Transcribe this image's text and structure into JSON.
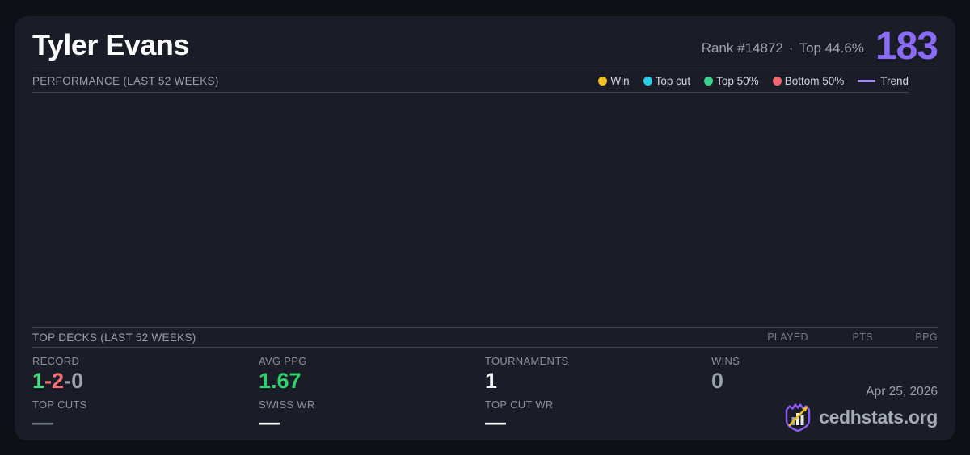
{
  "page": {
    "background": "#0f1015",
    "card_background": "#1a1d28"
  },
  "header": {
    "player_name": "Tyler Evans",
    "rank_text": "Rank #14872",
    "separator": "·",
    "top_percent": "Top 44.6%",
    "score": "183",
    "score_color": "#8b6af5"
  },
  "performance": {
    "title": "PERFORMANCE (LAST 52 WEEKS)",
    "legend": [
      {
        "label": "Win",
        "color": "#f0c020",
        "marker": "dot"
      },
      {
        "label": "Top cut",
        "color": "#29cde6",
        "marker": "dot"
      },
      {
        "label": "Top 50%",
        "color": "#3ecf8d",
        "marker": "dot"
      },
      {
        "label": "Bottom 50%",
        "color": "#f5676e",
        "marker": "dot"
      },
      {
        "label": "Trend",
        "color": "#a78bfa",
        "marker": "line"
      }
    ]
  },
  "chart_data": {
    "type": "scatter",
    "title": "PERFORMANCE (LAST 52 WEEKS)",
    "series": [],
    "empty": true
  },
  "top_decks": {
    "title": "TOP DECKS (LAST 52 WEEKS)",
    "columns": [
      "PLAYED",
      "PTS",
      "PPG"
    ],
    "rows": []
  },
  "stats": {
    "record": {
      "label": "RECORD",
      "parts": [
        {
          "text": "1",
          "color": "#4ade80"
        },
        {
          "text": "-",
          "color": "#f87174"
        },
        {
          "text": "2",
          "color": "#f87174"
        },
        {
          "text": "-",
          "color": "#9aa1ac"
        },
        {
          "text": "0",
          "color": "#9aa1ac"
        }
      ]
    },
    "avg_ppg": {
      "label": "AVG PPG",
      "value": "1.67",
      "color": "#31d36b"
    },
    "tournaments": {
      "label": "TOURNAMENTS",
      "value": "1",
      "color": "#f3f4f6"
    },
    "wins": {
      "label": "WINS",
      "value": "0",
      "color": "#9aa1ac"
    },
    "top_cuts": {
      "label": "TOP CUTS",
      "value": "—",
      "color": "#6b7280"
    },
    "swiss_wr": {
      "label": "SWISS WR",
      "value": "—",
      "color": "#ffffff"
    },
    "top_cut_wr": {
      "label": "TOP CUT WR",
      "value": "—",
      "color": "#ffffff"
    }
  },
  "footer": {
    "date": "Apr 25, 2026",
    "brand": "cedhstats.org",
    "logo_shield_color": "#8b5cf6",
    "logo_arrow_color": "#f0c020"
  }
}
